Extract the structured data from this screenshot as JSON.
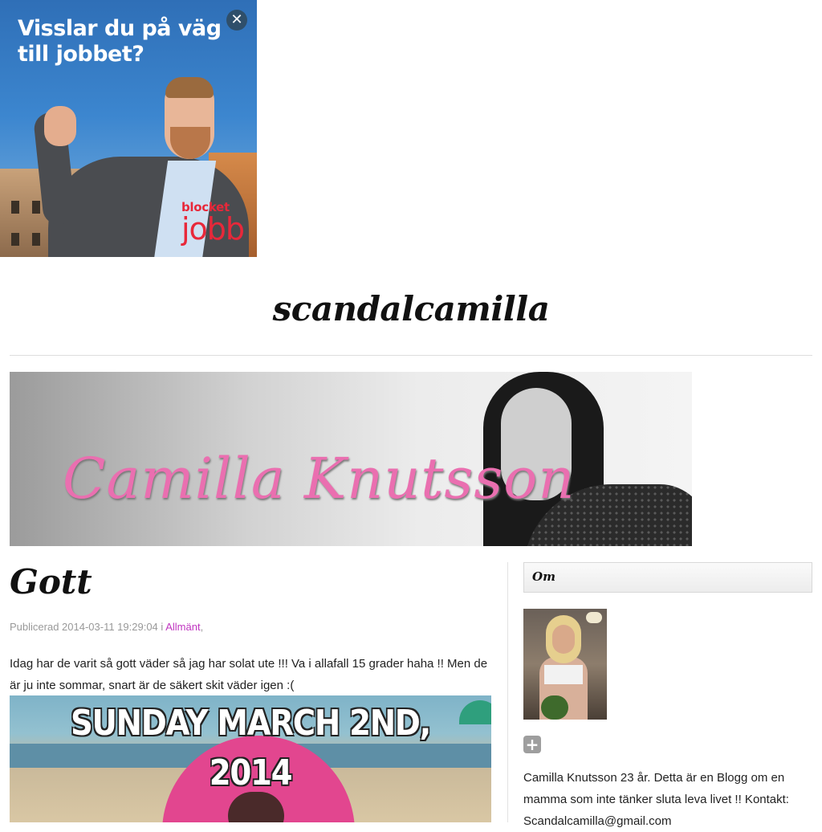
{
  "ad": {
    "headline": "Visslar du på väg till jobbet?",
    "close_glyph": "✕",
    "brand_top": "blocket",
    "brand_bottom": "jobb"
  },
  "site": {
    "title": "scandalcamilla"
  },
  "banner": {
    "name": "Camilla Knutsson"
  },
  "post": {
    "title": "Gott",
    "meta_prefix": "Publicerad 2014-03-11 19:29:04 i",
    "category": "Allmänt",
    "category_suffix": ",",
    "body": "Idag har de varit så gott väder så jag har solat ute !!! Va i allafall 15 grader haha !! Men de är ju inte sommar, snart är de säkert skit väder igen :(",
    "image_caption_line1": "SUNDAY MARCH 2ND,",
    "image_caption_line2": "2014"
  },
  "sidebar": {
    "widget_title": "Om",
    "expand_glyph": "+",
    "about_text": "Camilla Knutsson 23 år. Detta är en Blogg om en mamma som inte tänker sluta leva livet !! Kontakt: Scandalcamilla@gmail.com"
  },
  "colors": {
    "link": "#c036c0",
    "meta": "#999999",
    "brand_red": "#e8283a"
  }
}
